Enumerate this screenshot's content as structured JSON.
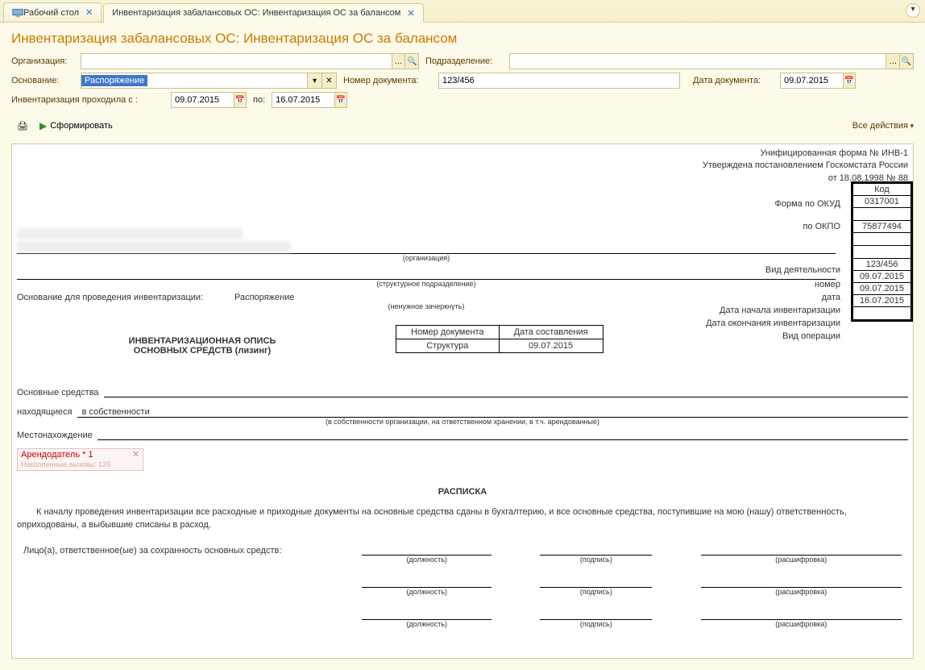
{
  "tabs": {
    "desktop": "Рабочий стол",
    "doc": "Инвентаризация забалансовых ОС: Инвентаризация ОС за балансом"
  },
  "title": "Инвентаризация забалансовых ОС: Инвентаризация ОС за балансом",
  "form": {
    "org_label": "Организация:",
    "dept_label": "Подразделение:",
    "basis_label": "Основание:",
    "basis_value": "Распоряжение",
    "docnum_label": "Номер документа:",
    "docnum_value": "123/456",
    "docdate_label": "Дата документа:",
    "docdate_value": "09.07.2015",
    "inv_period_label": "Инвентаризация проходила с :",
    "inv_from": "09.07.2015",
    "inv_to_label": "по:",
    "inv_to": "16.07.2015"
  },
  "toolbar": {
    "form_btn": "Сформировать",
    "all_actions": "Все действия"
  },
  "doc": {
    "hdr1": "Унифицированная форма № ИНВ-1",
    "hdr2": "Утверждена постановлением Госкомстата России",
    "hdr3": "от 18.08.1998 № 88",
    "code_hdr": "Код",
    "okud_label": "Форма по ОКУД",
    "okud": "0317001",
    "okpo_label": "по ОКПО",
    "okpo": "75877494",
    "org_sub": "(организация)",
    "dept_sub": "(структурное подразделение)",
    "activity_label": "Вид деятельности",
    "basis_line_label": "Основание для проведения инвентаризации:",
    "basis_line_value": "Распоряжение",
    "strike_note": "(ненужное зачеркнуть)",
    "num_label": "номер",
    "num_val": "123/456",
    "date_label": "дата",
    "date_val": "09.07.2015",
    "start_label": "Дата начала инвентаризации",
    "start_val": "09.07.2015",
    "end_label": "Дата окончания инвентаризации",
    "end_val": "16.07.2015",
    "op_label": "Вид операции",
    "doc_title1": "ИНВЕНТАРИЗАЦИОННАЯ ОПИСЬ",
    "doc_title2": "ОСНОВНЫХ СРЕДСТВ (лизинг)",
    "mini_h1": "Номер документа",
    "mini_h2": "Дата составления",
    "mini_v1": "Структура",
    "mini_v2": "09.07.2015",
    "os_label": "Основные средства",
    "loc_label": "находящиеся",
    "loc_val": "в собственности",
    "loc_sub": "(в собственности организации, на ответственном хранении, в т.ч. арендованные)",
    "place_label": "Местонахождение",
    "arend_label": "Арендодатель *",
    "arend_faint": "Накопленные вызовы: 139",
    "raspisska": "РАСПИСКА",
    "para": "К началу проведения инвентаризации все расходные и приходные документы на основные средства сданы в бухгалтерию, и все основные средства, поступившие на мою (нашу) ответственность, оприходованы, а выбывшие списаны в расход.",
    "resp_label": "Лицо(а), ответственное(ые) за сохранность основных средств:",
    "sig_post": "(должность)",
    "sig_sign": "(подпись)",
    "sig_name": "(расшифровка)"
  }
}
